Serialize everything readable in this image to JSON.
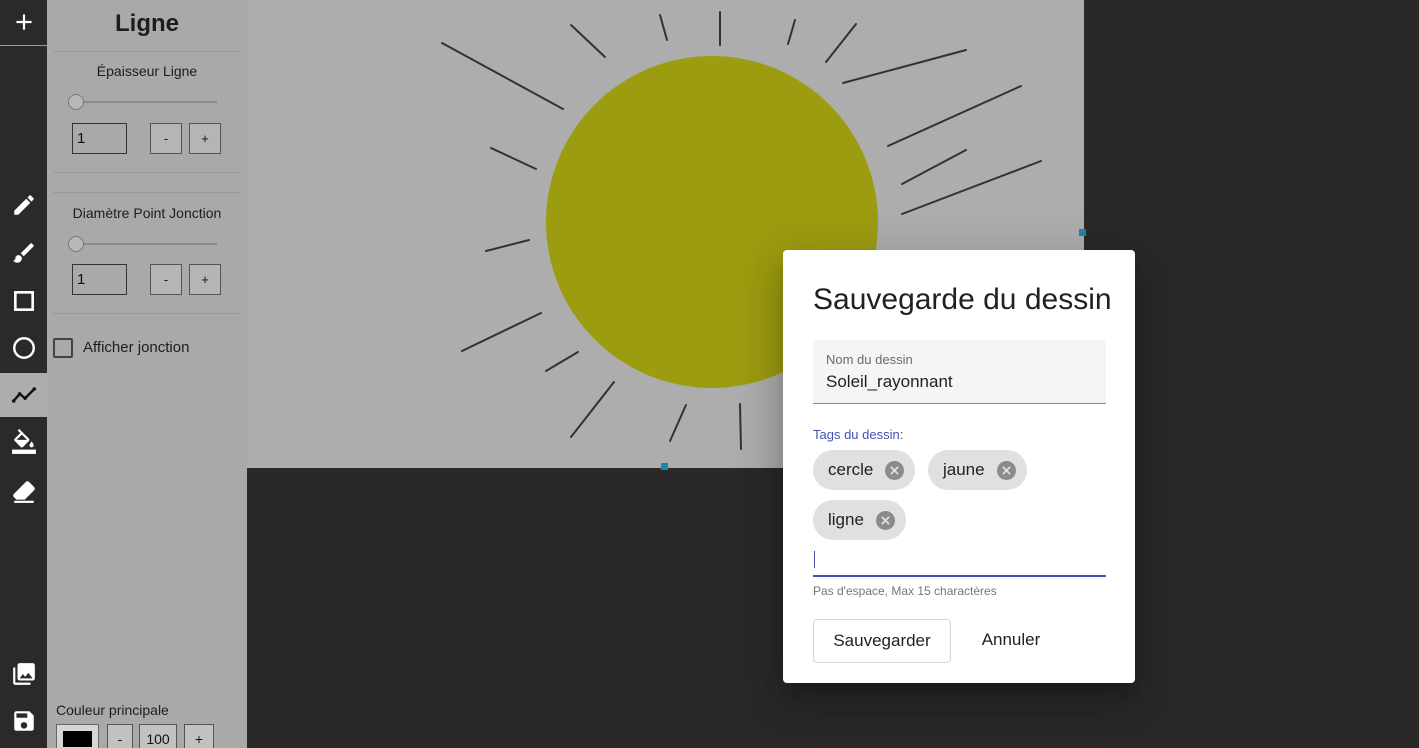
{
  "toolbar": {
    "tools": [
      {
        "id": "new-drawing",
        "icon": "plus-icon"
      },
      {
        "id": "pencil",
        "icon": "pencil-icon"
      },
      {
        "id": "brush",
        "icon": "brush-icon"
      },
      {
        "id": "rectangle",
        "icon": "square-icon"
      },
      {
        "id": "ellipse",
        "icon": "circle-icon"
      },
      {
        "id": "line",
        "icon": "polyline-icon",
        "active": true
      },
      {
        "id": "fill",
        "icon": "paint-bucket-icon"
      },
      {
        "id": "eraser",
        "icon": "eraser-icon"
      },
      {
        "id": "gallery",
        "icon": "gallery-icon"
      },
      {
        "id": "save",
        "icon": "save-icon"
      }
    ]
  },
  "panel": {
    "title": "Ligne",
    "thickness": {
      "label": "Épaisseur Ligne",
      "value": "1",
      "minus": "-",
      "plus": "+"
    },
    "junction_diameter": {
      "label": "Diamètre Point Jonction",
      "value": "1",
      "minus": "-",
      "plus": "+"
    },
    "show_junction": {
      "label": "Afficher jonction",
      "checked": false
    },
    "primary_color": {
      "label": "Couleur principale",
      "minus": "-",
      "opacity": "100",
      "plus": "+",
      "swatch": "#000000"
    }
  },
  "canvas": {
    "background": "#ffffff",
    "sun_color": "#e6e619",
    "ray_color": "#4a4a4a"
  },
  "dialog": {
    "title": "Sauvegarde du dessin",
    "name_label": "Nom du dessin",
    "name_value": "Soleil_rayonnant",
    "tags_label": "Tags du dessin:",
    "tags": [
      "cercle",
      "jaune",
      "ligne"
    ],
    "tag_hint": "Pas d'espace, Max 15 charactères",
    "save_label": "Sauvegarder",
    "cancel_label": "Annuler",
    "accent": "#3f51b5"
  }
}
